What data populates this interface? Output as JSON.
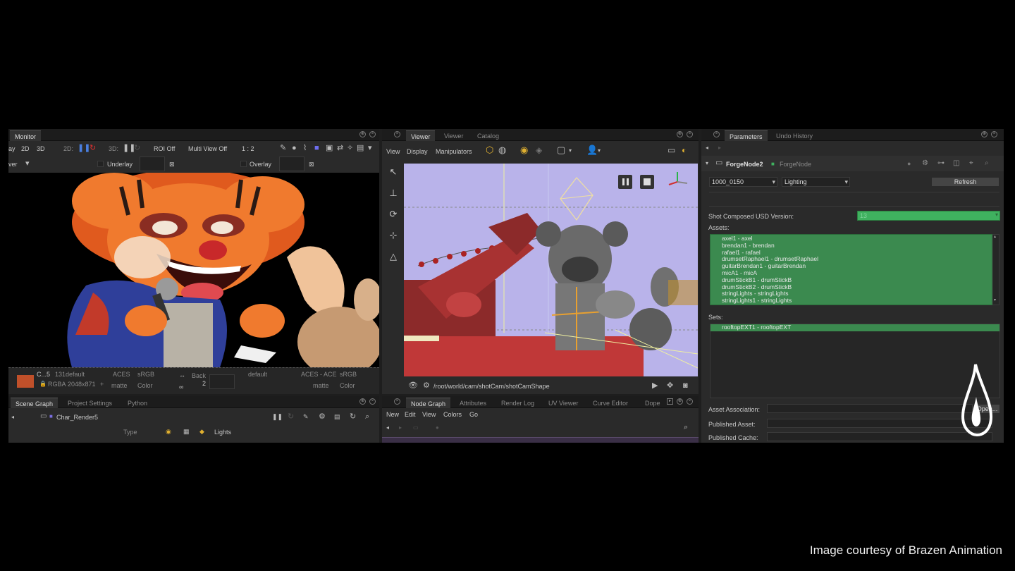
{
  "monitor": {
    "tabs": [
      "Monitor"
    ],
    "toolbar": {
      "lay": "ay",
      "d2": "2D",
      "d3": "3D",
      "pick2d": "2D:",
      "pick3d": "3D:",
      "roi": "ROI Off",
      "multiview": "Multi View Off",
      "ratio": "1 : 2"
    },
    "row2": {
      "view": "ver",
      "underlay": "Underlay",
      "overlay": "Overlay"
    },
    "footer": {
      "name": "C...5",
      "default1": "131default",
      "aces1": "ACES",
      "srgb1": "sRGB",
      "rgba": "RGBA",
      "size": "2048x871",
      "plus": "+",
      "matte1": "matte",
      "color1": "Color",
      "back": "Back",
      "back_value": "2",
      "default2": "default",
      "aces2": "ACES - ACE",
      "srgb2": "sRGB",
      "matte2": "matte",
      "color2": "Color"
    }
  },
  "viewer": {
    "tabs": [
      "Viewer",
      "Viewer",
      "Catalog"
    ],
    "menu": [
      "View",
      "Display",
      "Manipulators"
    ],
    "path": "/root/world/cam/shotCam/shotCamShape"
  },
  "scene_graph": {
    "tabs": [
      "Scene Graph",
      "Project Settings",
      "Python"
    ],
    "node": "Char_Render5",
    "columns": {
      "type": "Type",
      "lights": "Lights"
    }
  },
  "node_graph": {
    "tabs": [
      "Node Graph",
      "Attributes",
      "Render Log",
      "UV Viewer",
      "Curve Editor",
      "Dope"
    ],
    "menu": [
      "New",
      "Edit",
      "View",
      "Colors",
      "Go"
    ]
  },
  "parameters": {
    "tabs": [
      "Parameters",
      "Undo History"
    ],
    "node_name": "ForgeNode2",
    "node_type": "ForgeNode",
    "shot": "1000_0150",
    "dept": "Lighting",
    "refresh": "Refresh",
    "usd_label": "Shot Composed USD Version:",
    "usd_value": "13",
    "assets_label": "Assets:",
    "assets": [
      "axel1 - axel",
      "brendan1 - brendan",
      "rafael1 - rafael",
      "drumsetRaphael1 - drumsetRaphael",
      "guitarBrendan1 - guitarBrendan",
      "micA1 - micA",
      "drumStickB1 - drumStickB",
      "drumStickB2 - drumStickB",
      "stringLights - stringLights",
      "stringLights1 - stringLights"
    ],
    "sets_label": "Sets:",
    "sets": [
      "rooftopEXT1 - rooftopEXT"
    ],
    "asset_association": "Asset Association:",
    "open_btn": "Open...",
    "published_asset": "Published Asset:",
    "published_cache": "Published Cache:"
  },
  "credit": "Image courtesy of Brazen Animation",
  "colors": {
    "accent_green": "#3b8a4f",
    "usd_green": "#3fb15f",
    "viewport_bg": "#b9b3ea"
  }
}
